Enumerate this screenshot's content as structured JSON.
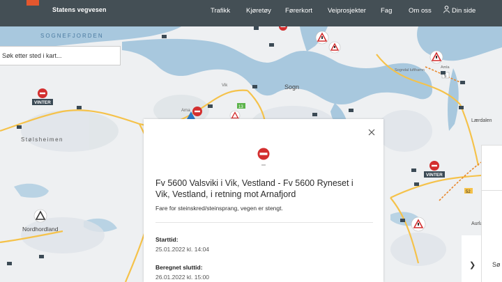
{
  "header": {
    "brand": "Statens vegvesen",
    "nav": [
      "Trafikk",
      "Kjøretøy",
      "Førerkort",
      "Veiprosjekter",
      "Fag",
      "Om oss",
      "Din side"
    ]
  },
  "search": {
    "placeholder": "Søk etter sted i kart..."
  },
  "map": {
    "labels": {
      "sognefjorden": "SOGNEFJORDEN",
      "sogn": "Sogn",
      "stolsheimen": "Stølsheimen",
      "nordhordland": "Nordhordland",
      "laerdalen": "Lærdalen",
      "aurland": "Aurlands",
      "vik": "Vik",
      "arna": "Arna",
      "vinter1": "VINTER",
      "vinter2": "VINTER",
      "kaupanger": "Sogndal lufthamn",
      "amla": "Amla",
      "road_52": "52",
      "road_13": "13",
      "road_5": "5"
    }
  },
  "panel": {
    "title": "Fv 5600 Valsviki i Vik, Vestland - Fv 5600 Ryneset i Vik, Vestland, i retning mot Arnafjord",
    "description": "Fare for steinskred/steinsprang, vegen er stengt.",
    "start_label": "Starttid:",
    "start_value": "25.01.2022 kl. 14:04",
    "end_label": "Beregnet sluttid:",
    "end_value": "26.01.2022 kl. 15:00"
  },
  "right_panel": {
    "text": "Sø"
  },
  "colors": {
    "header": "#444f55",
    "water": "#a8c8de",
    "land": "#eef0f2",
    "road": "#f5c24a",
    "ferry": "#e8872a",
    "closed": "#d32f2f"
  }
}
